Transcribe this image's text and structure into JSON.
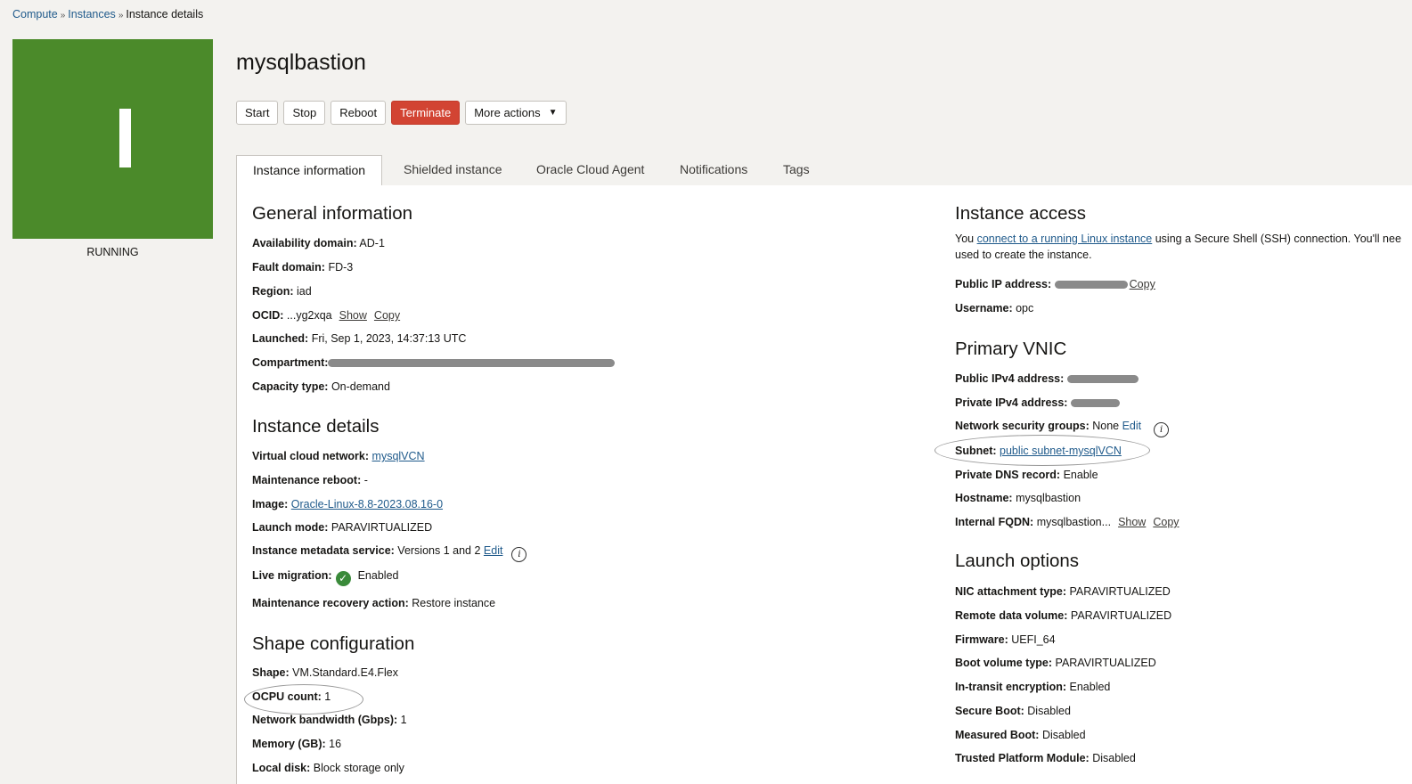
{
  "breadcrumb": {
    "compute": "Compute",
    "instances": "Instances",
    "current": "Instance details"
  },
  "instance": {
    "name": "mysqlbastion",
    "avatar_letter": "I",
    "state": "RUNNING",
    "avatar_color": "#4b8a2a"
  },
  "actions": {
    "start": "Start",
    "stop": "Stop",
    "reboot": "Reboot",
    "terminate": "Terminate",
    "more": "More actions"
  },
  "tabs": [
    "Instance information",
    "Shielded instance",
    "Oracle Cloud Agent",
    "Notifications",
    "Tags"
  ],
  "general": {
    "heading": "General information",
    "availability_domain": {
      "label": "Availability domain:",
      "value": "AD-1"
    },
    "fault_domain": {
      "label": "Fault domain:",
      "value": "FD-3"
    },
    "region": {
      "label": "Region:",
      "value": "iad"
    },
    "ocid": {
      "label": "OCID:",
      "value": "...yg2xqa",
      "show": "Show",
      "copy": "Copy"
    },
    "launched": {
      "label": "Launched:",
      "value": "Fri, Sep 1, 2023, 14:37:13 UTC"
    },
    "compartment": {
      "label": "Compartment:"
    },
    "capacity_type": {
      "label": "Capacity type:",
      "value": "On-demand"
    }
  },
  "details": {
    "heading": "Instance details",
    "vcn": {
      "label": "Virtual cloud network:",
      "value": "mysqlVCN"
    },
    "maintenance_reboot": {
      "label": "Maintenance reboot:",
      "value": "-"
    },
    "image": {
      "label": "Image:",
      "value": "Oracle-Linux-8.8-2023.08.16-0"
    },
    "launch_mode": {
      "label": "Launch mode:",
      "value": "PARAVIRTUALIZED"
    },
    "metadata_service": {
      "label": "Instance metadata service:",
      "value": "Versions 1 and 2",
      "edit": "Edit"
    },
    "live_migration": {
      "label": "Live migration:",
      "value": "Enabled"
    },
    "recovery_action": {
      "label": "Maintenance recovery action:",
      "value": "Restore instance"
    }
  },
  "shape": {
    "heading": "Shape configuration",
    "shape": {
      "label": "Shape:",
      "value": "VM.Standard.E4.Flex"
    },
    "ocpu": {
      "label": "OCPU count:",
      "value": "1"
    },
    "bandwidth": {
      "label": "Network bandwidth (Gbps):",
      "value": "1"
    },
    "memory": {
      "label": "Memory (GB):",
      "value": "16"
    },
    "local_disk": {
      "label": "Local disk:",
      "value": "Block storage only"
    }
  },
  "access": {
    "heading": "Instance access",
    "text_before": "You ",
    "link": "connect to a running Linux instance",
    "text_after": " using a Secure Shell (SSH) connection. You'll nee",
    "text_line2": "used to create the instance.",
    "public_ip": {
      "label": "Public IP address:",
      "copy": "Copy"
    },
    "username": {
      "label": "Username:",
      "value": "opc"
    }
  },
  "vnic": {
    "heading": "Primary VNIC",
    "public_ipv4": {
      "label": "Public IPv4 address:"
    },
    "private_ipv4": {
      "label": "Private IPv4 address:"
    },
    "nsg": {
      "label": "Network security groups:",
      "value": "None",
      "edit": "Edit"
    },
    "subnet": {
      "label": "Subnet:",
      "value": "public subnet-mysqlVCN"
    },
    "dns": {
      "label": "Private DNS record:",
      "value": "Enable"
    },
    "hostname": {
      "label": "Hostname:",
      "value": "mysqlbastion"
    },
    "fqdn": {
      "label": "Internal FQDN:",
      "value": "mysqlbastion...",
      "show": "Show",
      "copy": "Copy"
    }
  },
  "launch": {
    "heading": "Launch options",
    "nic": {
      "label": "NIC attachment type:",
      "value": "PARAVIRTUALIZED"
    },
    "remote_volume": {
      "label": "Remote data volume:",
      "value": "PARAVIRTUALIZED"
    },
    "firmware": {
      "label": "Firmware:",
      "value": "UEFI_64"
    },
    "boot_volume": {
      "label": "Boot volume type:",
      "value": "PARAVIRTUALIZED"
    },
    "encryption": {
      "label": "In-transit encryption:",
      "value": "Enabled"
    },
    "secure_boot": {
      "label": "Secure Boot:",
      "value": "Disabled"
    },
    "measured_boot": {
      "label": "Measured Boot:",
      "value": "Disabled"
    },
    "tpm": {
      "label": "Trusted Platform Module:",
      "value": "Disabled"
    }
  }
}
